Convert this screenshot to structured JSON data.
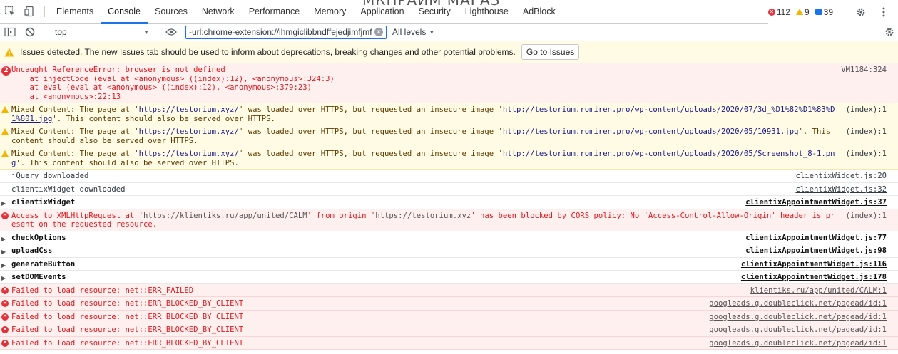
{
  "page_ghost_title": "МКПРАЙМ МАГАЗ",
  "tabs": [
    "Elements",
    "Console",
    "Sources",
    "Network",
    "Performance",
    "Memory",
    "Application",
    "Security",
    "Lighthouse",
    "AdBlock"
  ],
  "active_tab": "Console",
  "counts": {
    "errors": "112",
    "warnings": "9",
    "info": "39"
  },
  "toolbar": {
    "context": "top",
    "filter_value": "-url:chrome-extension://ihmgiclibbndffejedjimfjmf",
    "levels": "All levels"
  },
  "issues": {
    "message": "Issues detected. The new Issues tab should be used to inform about deprecations, breaking changes and other potential problems.",
    "button": "Go to Issues"
  },
  "messages": [
    {
      "type": "error",
      "icon": "2",
      "text": "Uncaught ReferenceError: browser is not defined",
      "stack": [
        "    at injectCode (eval at <anonymous> ((index):12), <anonymous>:324:3)",
        "    at eval (eval at <anonymous> ((index):12), <anonymous>:379:23)",
        "    at <anonymous>:22:13"
      ],
      "source": "VM1184:324"
    },
    {
      "type": "warning",
      "text": "Mixed Content: The page at 'https://testorium.xyz/' was loaded over HTTPS, but requested an insecure image 'http://testorium.romiren.pro/wp-content/uploads/2020/07/3d_%D1%82%D1%83%D1%801.jpg'. This content should also be served over HTTPS.",
      "source": "(index):1"
    },
    {
      "type": "warning",
      "text": "Mixed Content: The page at 'https://testorium.xyz/' was loaded over HTTPS, but requested an insecure image 'http://testorium.romiren.pro/wp-content/uploads/2020/05/10931.jpg'. This content should also be served over HTTPS.",
      "source": "(index):1"
    },
    {
      "type": "warning",
      "text": "Mixed Content: The page at 'https://testorium.xyz/' was loaded over HTTPS, but requested an insecure image 'http://testorium.romiren.pro/wp-content/uploads/2020/05/Screenshot_8-1.png'. This content should also be served over HTTPS.",
      "source": "(index):1"
    },
    {
      "type": "info",
      "text": "jQuery downloaded",
      "source": "clientixWidget.js:20"
    },
    {
      "type": "info",
      "text": "clientixWidget downloaded",
      "source": "clientixWidget.js:32"
    },
    {
      "type": "group",
      "text": "clientixWidget",
      "source": "clientixAppointmentWidget.js:37"
    },
    {
      "type": "error",
      "text": "Access to XMLHttpRequest at 'https://klientiks.ru/app/united/CALM' from origin 'https://testorium.xyz' has been blocked by CORS policy: No 'Access-Control-Allow-Origin' header is present on the requested resource.",
      "source": "(index):1"
    },
    {
      "type": "group",
      "text": "checkOptions",
      "source": "clientixAppointmentWidget.js:77"
    },
    {
      "type": "group",
      "text": "uploadCss",
      "source": "clientixAppointmentWidget.js:98"
    },
    {
      "type": "group",
      "text": "generateButton",
      "source": "clientixAppointmentWidget.js:116"
    },
    {
      "type": "group",
      "text": "setDOMEvents",
      "source": "clientixAppointmentWidget.js:178"
    },
    {
      "type": "error",
      "text": "Failed to load resource: net::ERR_FAILED",
      "source": "klientiks.ru/app/united/CALM:1"
    },
    {
      "type": "error",
      "text": "Failed to load resource: net::ERR_BLOCKED_BY_CLIENT",
      "source": "googleads.g.doubleclick.net/pagead/id:1"
    },
    {
      "type": "error",
      "text": "Failed to load resource: net::ERR_BLOCKED_BY_CLIENT",
      "source": "googleads.g.doubleclick.net/pagead/id:1"
    },
    {
      "type": "error",
      "text": "Failed to load resource: net::ERR_BLOCKED_BY_CLIENT",
      "source": "googleads.g.doubleclick.net/pagead/id:1"
    },
    {
      "type": "error",
      "text": "Failed to load resource: net::ERR_BLOCKED_BY_CLIENT",
      "source": "googleads.g.doubleclick.net/pagead/id:1"
    }
  ],
  "colors": {
    "accent": "#1a73e8",
    "error_bg": "#fff0f0",
    "warning_bg": "#fffbe5",
    "error_text": "#e0191e"
  },
  "icons": [
    "inspect-icon",
    "device-icon",
    "sidebar-icon",
    "clear-icon",
    "eye-icon",
    "gear-icon",
    "more-icon"
  ]
}
